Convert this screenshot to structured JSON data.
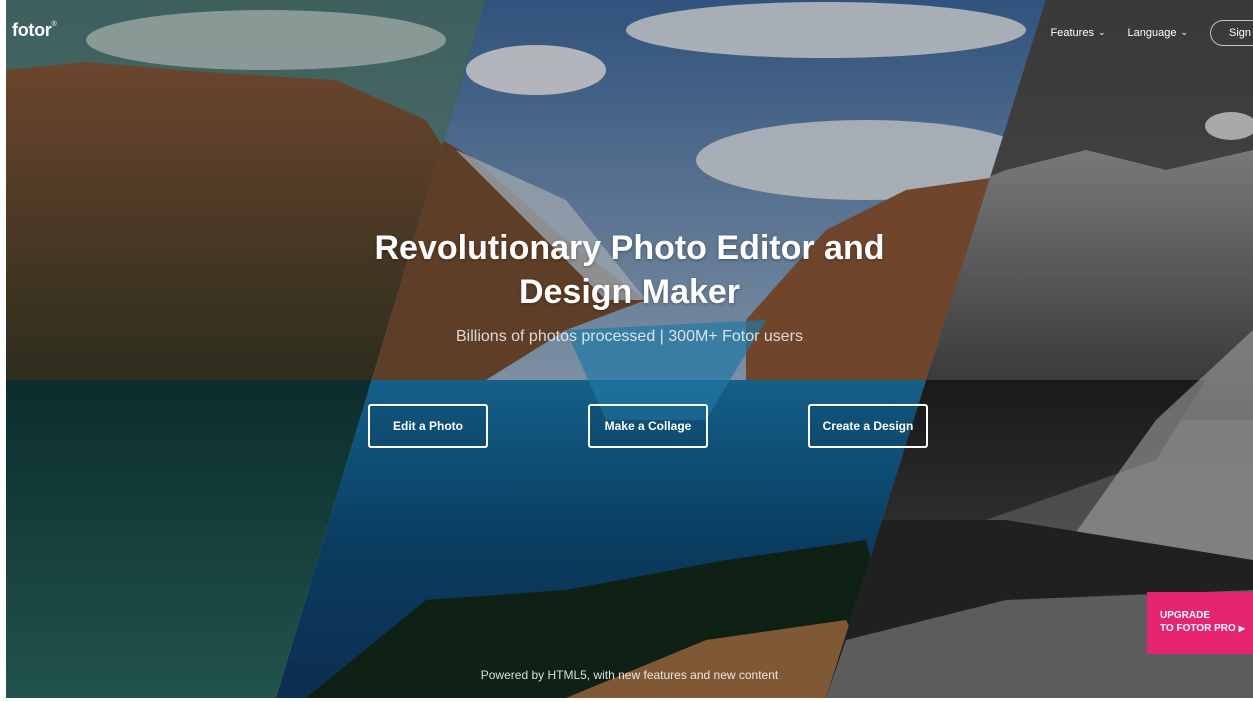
{
  "brand": {
    "logo_text": "fotor",
    "logo_mark": "®"
  },
  "nav": {
    "items": [
      {
        "label": "Features",
        "icon": "chevron-down-icon"
      },
      {
        "label": "Language",
        "icon": "chevron-down-icon"
      }
    ],
    "sign_label": "Sign"
  },
  "hero": {
    "title": "Revolutionary Photo Editor and Design Maker",
    "subtitle": "Billions of photos processed | 300M+ Fotor users"
  },
  "ctas": [
    {
      "label": "Edit a Photo"
    },
    {
      "label": "Make a Collage"
    },
    {
      "label": "Create a Design"
    }
  ],
  "footer": {
    "note": "Powered by HTML5, with new features and new content"
  },
  "upgrade": {
    "line1": "UPGRADE",
    "line2": "TO FOTOR PRO",
    "icon": "triangle-right-icon",
    "color": "#e6246f"
  },
  "colors": {
    "accent": "#e6246f",
    "text": "#ffffff"
  }
}
